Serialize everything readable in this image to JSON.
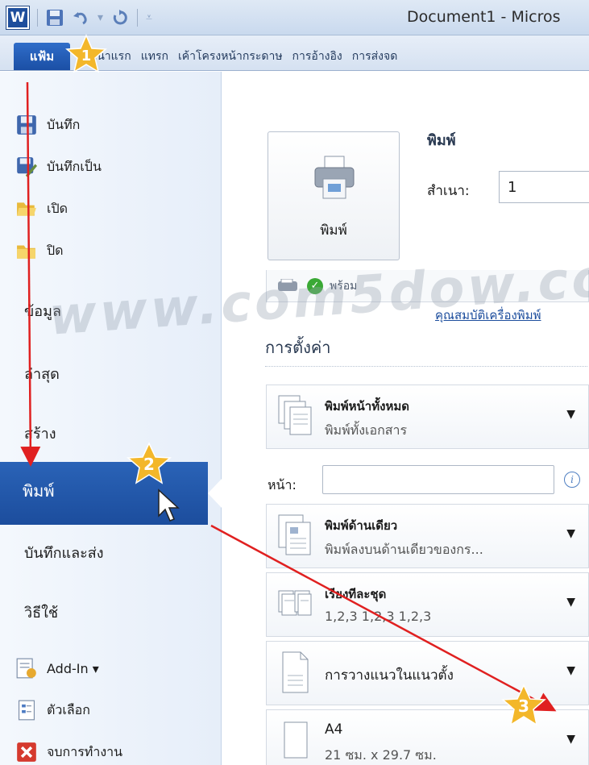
{
  "window": {
    "app_logo": "W",
    "title": "Document1 - Micros"
  },
  "ribbon": {
    "file_tab": "แฟ้ม",
    "tabs": [
      "หน้าแรก",
      "แทรก",
      "เค้าโครงหน้ากระดาษ",
      "การอ้างอิง",
      "การส่งจด"
    ]
  },
  "nav": {
    "commands": [
      {
        "label": "บันทึก",
        "icon": "save-icon"
      },
      {
        "label": "บันทึกเป็น",
        "icon": "save-as-icon"
      },
      {
        "label": "เปิด",
        "icon": "open-folder-icon"
      },
      {
        "label": "ปิด",
        "icon": "close-folder-icon"
      }
    ],
    "tabs": [
      "ข้อมูล",
      "ล่าสุด",
      "สร้าง",
      "พิมพ์",
      "บันทึกและส่ง",
      "วิธีใช้"
    ],
    "active_tab": "พิมพ์",
    "bottom": [
      {
        "label": "Add-In ▾",
        "icon": "add-in-icon"
      },
      {
        "label": "ตัวเลือก",
        "icon": "options-icon"
      },
      {
        "label": "จบการทำงาน",
        "icon": "exit-icon"
      }
    ]
  },
  "print": {
    "button_label": "พิมพ์",
    "heading": "พิมพ์",
    "copies_label": "สำเนา:",
    "copies_value": "1",
    "printer_status": "พร้อม",
    "printer_properties_link": "คุณสมบัติเครื่องพิมพ์",
    "settings_heading": "การตั้งค่า",
    "print_what": {
      "title": "พิมพ์หน้าทั้งหมด",
      "subtitle": "พิมพ์ทั้งเอกสาร"
    },
    "pages_label": "หน้า:",
    "pages_value": "",
    "sides": {
      "title": "พิมพ์ด้านเดียว",
      "subtitle": "พิมพ์ลงบนด้านเดียวของกร..."
    },
    "collate": {
      "title": "เรียงทีละชุด",
      "subtitle": "1,2,3    1,2,3    1,2,3"
    },
    "orientation": {
      "title": "การวางแนวในแนวตั้ง"
    },
    "paper": {
      "title": "A4",
      "subtitle": "21 ซม. x 29.7 ซม."
    }
  },
  "annotations": {
    "steps": [
      "1",
      "2",
      "3"
    ],
    "watermark": "www.com5dow.com",
    "arrow_color": "#e02020",
    "star_color": "#f3b72a"
  }
}
